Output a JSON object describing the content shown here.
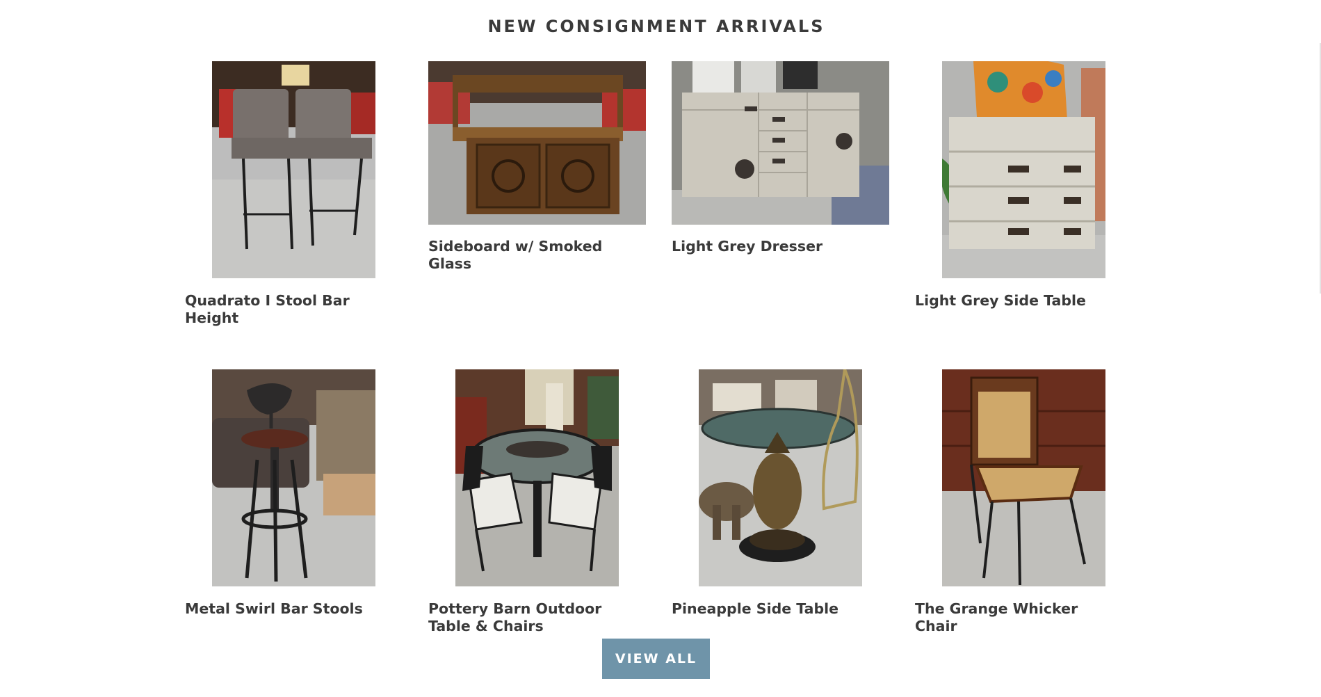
{
  "section": {
    "title": "NEW CONSIGNMENT ARRIVALS"
  },
  "products": [
    {
      "title": "Quadrato I Stool Bar Height"
    },
    {
      "title": "Sideboard w/ Smoked Glass"
    },
    {
      "title": "Light Grey Dresser"
    },
    {
      "title": "Light Grey Side Table"
    },
    {
      "title": "Metal Swirl Bar Stools"
    },
    {
      "title": "Pottery Barn Outdoor Table & Chairs"
    },
    {
      "title": "Pineapple Side Table"
    },
    {
      "title": "The Grange Whicker Chair"
    }
  ],
  "button": {
    "view_all": "VIEW ALL"
  },
  "colors": {
    "button_bg": "#6f94a9",
    "heading": "#3a3a3a"
  }
}
